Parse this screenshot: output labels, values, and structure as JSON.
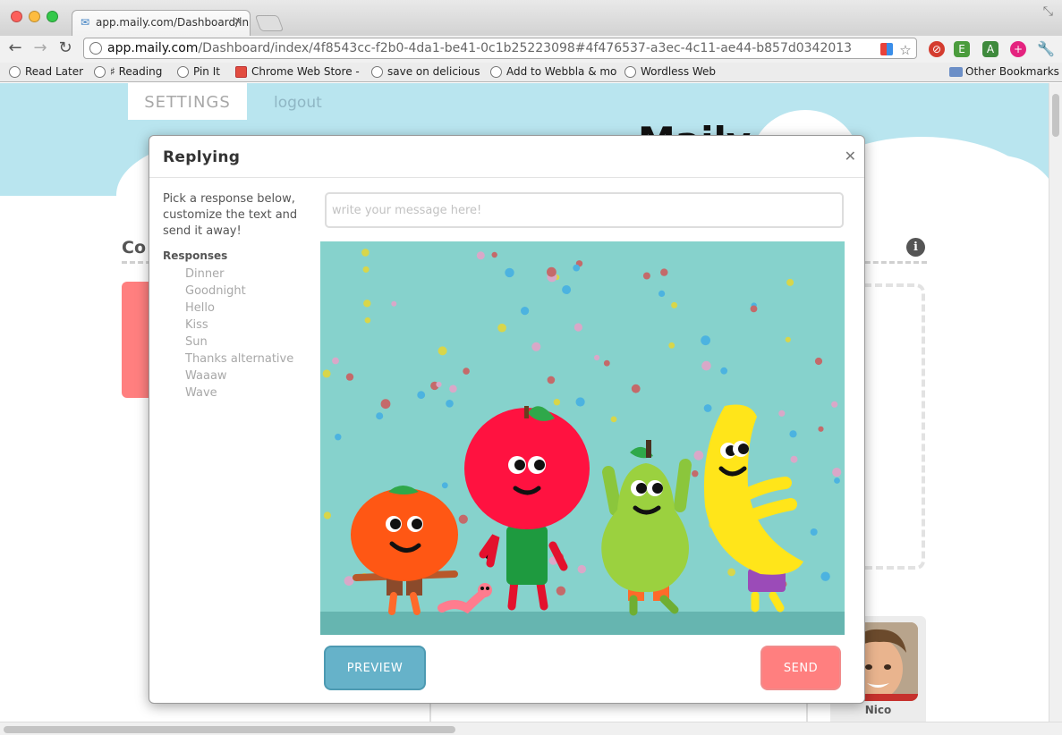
{
  "browser": {
    "tab_title": "app.maily.com/Dashboard/in",
    "url_host": "app.maily.com",
    "url_path": "/Dashboard/index/4f8543cc-f2b0-4da1-be41-0c1b25223098#4f476537-a3ec-4c11-ae44-b857d0342013",
    "bookmarks": [
      "Read Later",
      "♯ Reading",
      "Pin It",
      "Chrome Web Store -",
      "save on delicious",
      "Add to Webbla & mo",
      "Wordless Web"
    ],
    "other_bookmarks": "Other Bookmarks",
    "traffic_colors": [
      "#fc605b",
      "#fdbc40",
      "#34c84a"
    ]
  },
  "page": {
    "settings_label": "SETTINGS",
    "logout_label": "logout",
    "logo_text": "Maily",
    "bg_heading": "Co",
    "avatar_name": "Nico"
  },
  "modal": {
    "title": "Replying",
    "close_icon": "close-icon",
    "instructions": "Pick a response below, customize the text and send it away!",
    "responses_heading": "Responses",
    "responses": [
      "Dinner",
      "Goodnight",
      "Hello",
      "Kiss",
      "Sun",
      "Thanks alternative",
      "Waaaw",
      "Wave"
    ],
    "message_placeholder": "write your message here!",
    "message_value": "",
    "preview_label": "PREVIEW",
    "send_label": "SEND"
  },
  "colors": {
    "sky": "#b9e5ef",
    "card_bg": "#86d2cc",
    "preview_button": "#66b2c9",
    "send_button": "#ff7f7f"
  }
}
